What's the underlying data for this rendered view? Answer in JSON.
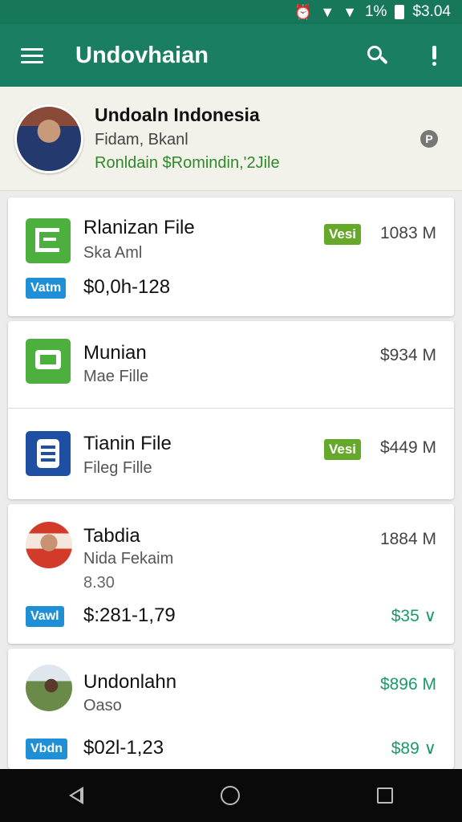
{
  "status_bar": {
    "percent": "1%",
    "time": "$3.04"
  },
  "app_bar": {
    "title": "Undovhaian"
  },
  "profile": {
    "name": "Undoaln Indonesia",
    "subtitle": "Fidam, Bkanl",
    "link": "Ronldain $Romindin,'2Jile",
    "info": "P"
  },
  "cards": {
    "c1": {
      "title": "Rlanizan File",
      "sub": "Ska Aml",
      "badge": "Vesi",
      "size": "1083 M",
      "tag": "Vatm",
      "price": "$0,0h-128"
    },
    "c2": {
      "title": "Munian",
      "sub": "Mae Fille",
      "size": "$934 M"
    },
    "c3": {
      "title": "Tianin File",
      "sub": "Fileg Fille",
      "badge": "Vesi",
      "size": "$449 M"
    },
    "c4": {
      "title": "Tabdia",
      "sub": "Nida Fekaim",
      "sub2": "8.30",
      "size": "1884 M",
      "tag": "Vawl",
      "price": "$:281-1,79",
      "price_right": "$35 ∨"
    },
    "c5": {
      "title": "Undonlahn",
      "sub": "Oaso",
      "size": "$896 M",
      "tag": "Vbdn",
      "price": "$02l-1,23",
      "price_right": "$89 ∨"
    }
  },
  "colors": {
    "app_bar": "#1a7f62",
    "accent_green": "#65a82a",
    "accent_blue": "#1f8fd6"
  }
}
